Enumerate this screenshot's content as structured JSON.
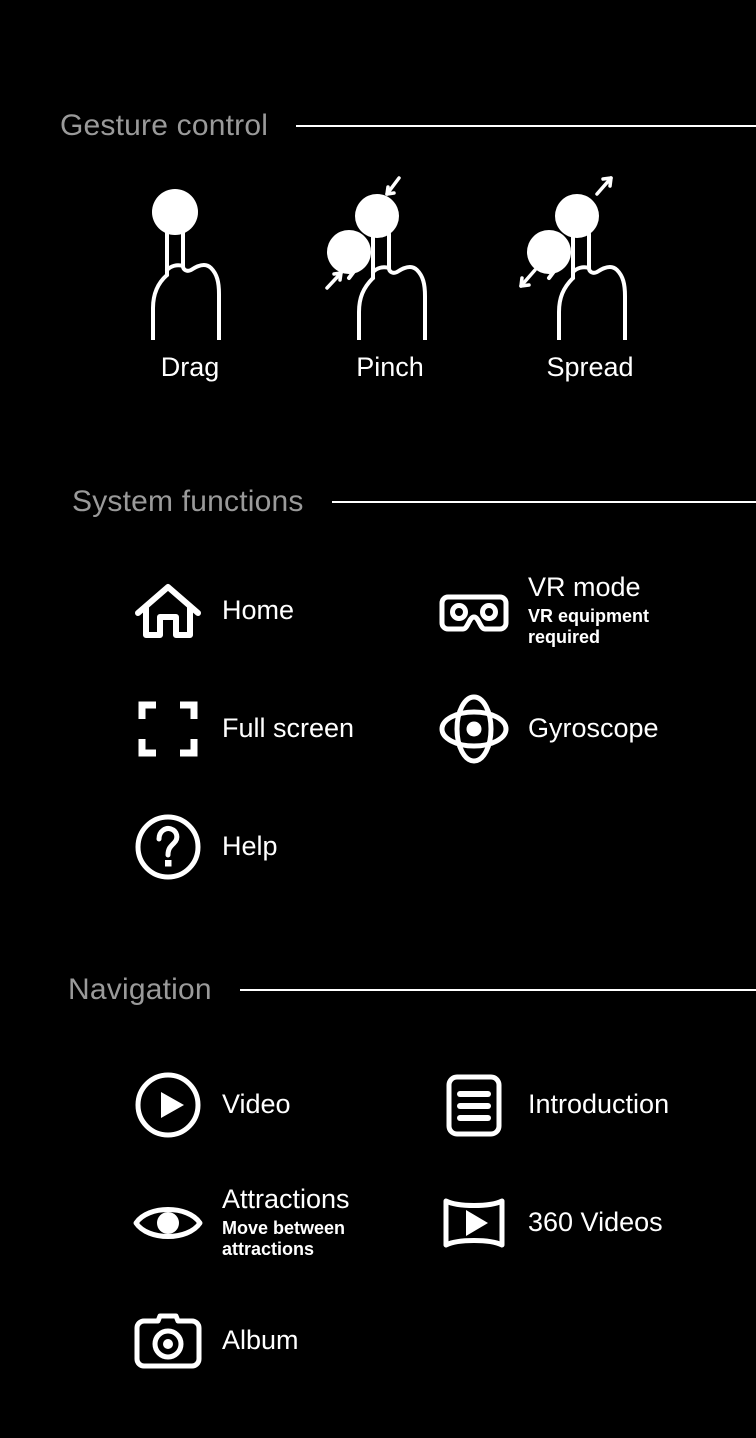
{
  "sections": {
    "gesture": {
      "title": "Gesture control",
      "items": [
        {
          "label": "Drag",
          "icon": "one-finger-drag-icon"
        },
        {
          "label": "Pinch",
          "icon": "two-finger-pinch-icon"
        },
        {
          "label": "Spread",
          "icon": "two-finger-spread-icon"
        }
      ]
    },
    "system": {
      "title": "System functions",
      "items": [
        {
          "label": "Home",
          "sub": "",
          "icon": "home-icon"
        },
        {
          "label": "VR mode",
          "sub": "VR equipment required",
          "icon": "vr-goggles-icon"
        },
        {
          "label": "Full screen",
          "sub": "",
          "icon": "fullscreen-icon"
        },
        {
          "label": "Gyroscope",
          "sub": "",
          "icon": "gyroscope-icon"
        },
        {
          "label": "Help",
          "sub": "",
          "icon": "question-mark-circle-icon"
        }
      ]
    },
    "navigation": {
      "title": "Navigation",
      "items": [
        {
          "label": "Video",
          "sub": "",
          "icon": "play-circle-icon"
        },
        {
          "label": "Introduction",
          "sub": "",
          "icon": "document-lines-icon"
        },
        {
          "label": "Attractions",
          "sub": "Move between attractions",
          "icon": "eye-icon"
        },
        {
          "label": "360 Videos",
          "sub": "",
          "icon": "panorama-play-icon"
        },
        {
          "label": "Album",
          "sub": "",
          "icon": "camera-icon"
        }
      ]
    }
  },
  "colors": {
    "background": "#000000",
    "section_title": "#9a9a9a",
    "foreground": "#ffffff"
  }
}
